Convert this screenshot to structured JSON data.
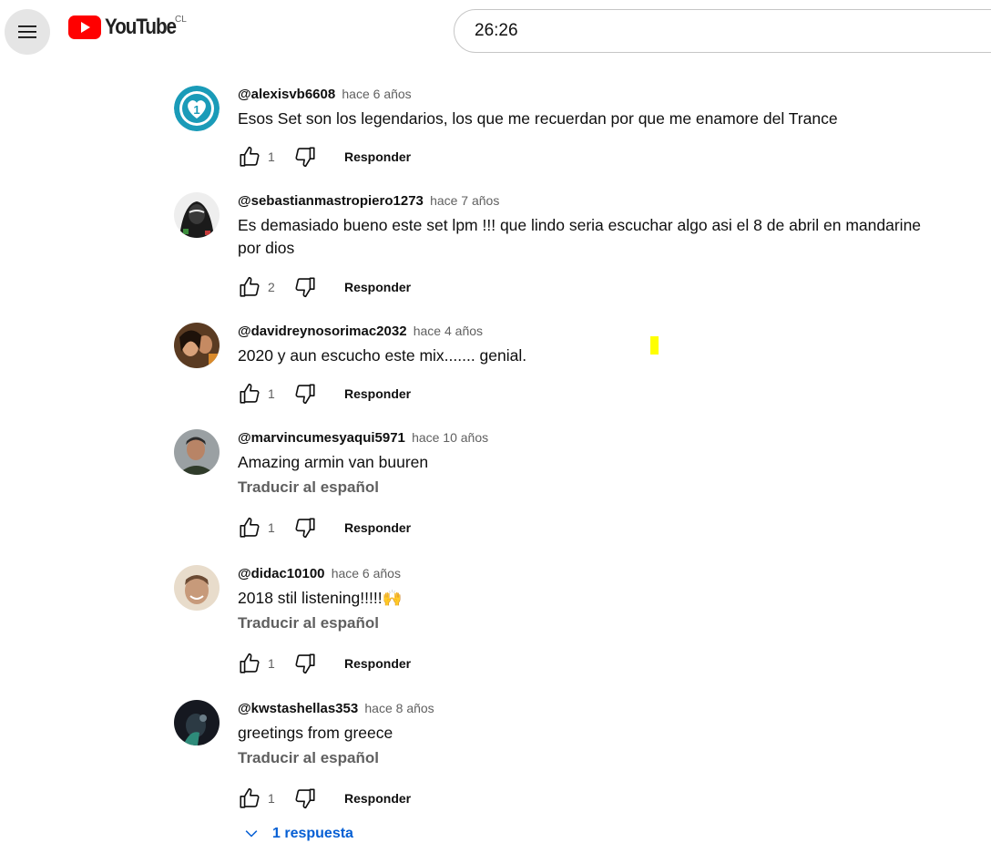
{
  "header": {
    "logo_text": "YouTube",
    "country_code": "CL",
    "search_value": "26:26",
    "brand_color": "#ff0000"
  },
  "comments": [
    {
      "author": "@alexisvb6608",
      "time": "hace 6 años",
      "text": "Esos Set son los legendarios, los que me recuerdan por que me enamore del Trance",
      "likes": "1",
      "reply_label": "Responder"
    },
    {
      "author": "@sebastianmastropiero1273",
      "time": "hace 7 años",
      "text": "Es demasiado bueno este set lpm  !!!  que lindo seria escuchar algo asi el 8 de abril en mandarine por dios",
      "likes": "2",
      "reply_label": "Responder"
    },
    {
      "author": "@davidreynosorimac2032",
      "time": "hace 4 años",
      "text": "2020 y aun escucho este mix....... genial.",
      "likes": "1",
      "reply_label": "Responder"
    },
    {
      "author": "@marvincumesyaqui5971",
      "time": "hace 10 años",
      "text": "Amazing armin van buuren",
      "translate": "Traducir al español",
      "likes": "1",
      "reply_label": "Responder"
    },
    {
      "author": "@didac10100",
      "time": "hace 6 años",
      "text": "2018 stil listening!!!!!🙌",
      "translate": "Traducir al español",
      "likes": "1",
      "reply_label": "Responder"
    },
    {
      "author": "@kwstashellas353",
      "time": "hace 8 años",
      "text": "greetings from greece",
      "translate": "Traducir al español",
      "likes": "1",
      "reply_label": "Responder",
      "replies_label": "1 respuesta"
    }
  ],
  "accent_link_color": "#065fd4"
}
